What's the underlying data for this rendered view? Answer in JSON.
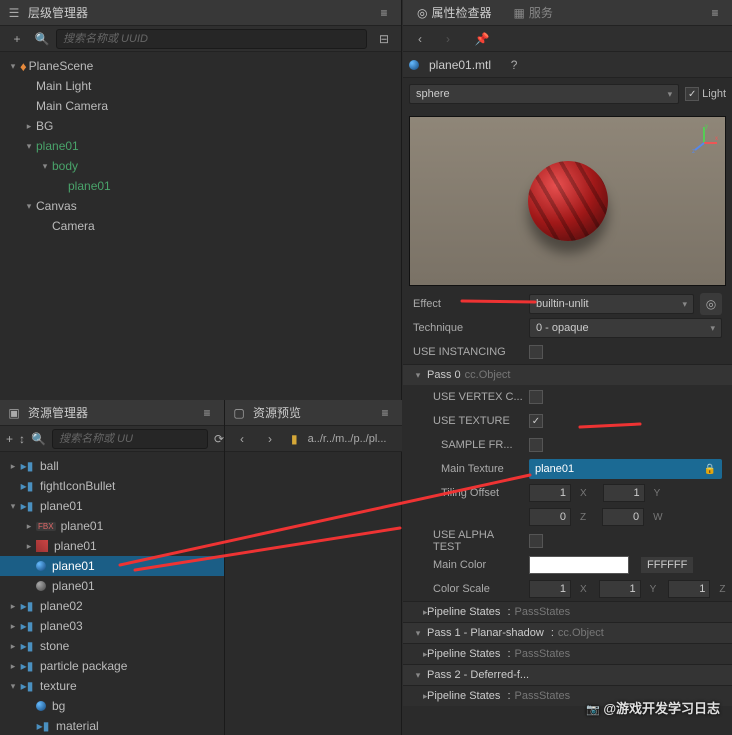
{
  "hierarchy": {
    "title": "层级管理器",
    "search_placeholder": "搜索名称或 UUID",
    "tree": [
      {
        "icon": "fire",
        "label": "PlaneScene",
        "depth": 0,
        "caret": "down"
      },
      {
        "icon": "",
        "label": "Main Light",
        "depth": 1
      },
      {
        "icon": "",
        "label": "Main Camera",
        "depth": 1
      },
      {
        "icon": "",
        "label": "BG",
        "depth": 1,
        "caret": "right"
      },
      {
        "icon": "",
        "label": "plane01",
        "depth": 1,
        "caret": "down",
        "active": true
      },
      {
        "icon": "",
        "label": "body",
        "depth": 2,
        "caret": "down",
        "active": true
      },
      {
        "icon": "",
        "label": "plane01",
        "depth": 3,
        "active": true
      },
      {
        "icon": "",
        "label": "Canvas",
        "depth": 1,
        "caret": "down"
      },
      {
        "icon": "",
        "label": "Camera",
        "depth": 2
      }
    ]
  },
  "assets": {
    "title": "资源管理器",
    "search_placeholder": "搜索名称或 UU",
    "tree": [
      {
        "icon": "folder",
        "label": "ball",
        "depth": 0,
        "caret": "right"
      },
      {
        "icon": "folder",
        "label": "fightIconBullet",
        "depth": 0
      },
      {
        "icon": "folder",
        "label": "plane01",
        "depth": 0,
        "caret": "down"
      },
      {
        "icon": "fbx",
        "label": "plane01",
        "depth": 1,
        "caret": "right"
      },
      {
        "icon": "img",
        "label": "plane01",
        "depth": 1,
        "caret": "right"
      },
      {
        "icon": "sphere-blue",
        "label": "plane01",
        "depth": 1,
        "selected": true
      },
      {
        "icon": "sphere-gray",
        "label": "plane01",
        "depth": 1
      },
      {
        "icon": "folder",
        "label": "plane02",
        "depth": 0,
        "caret": "right"
      },
      {
        "icon": "folder",
        "label": "plane03",
        "depth": 0,
        "caret": "right"
      },
      {
        "icon": "folder",
        "label": "stone",
        "depth": 0,
        "caret": "right"
      },
      {
        "icon": "folder",
        "label": "particle package",
        "depth": 0,
        "caret": "right"
      },
      {
        "icon": "folder",
        "label": "texture",
        "depth": 0,
        "caret": "down"
      },
      {
        "icon": "sphere-blue",
        "label": "bg",
        "depth": 1
      },
      {
        "icon": "folder",
        "label": "material",
        "depth": 1
      }
    ]
  },
  "preview": {
    "title": "资源预览",
    "breadcrumb": "a../r../m../p../pl..."
  },
  "inspector": {
    "title": "属性检查器",
    "services_tab": "服务",
    "asset_name": "plane01.mtl",
    "preview_mesh": "sphere",
    "light_label": "Light",
    "effect_label": "Effect",
    "effect_value": "builtin-unlit",
    "technique_label": "Technique",
    "technique_value": "0 - opaque",
    "use_instancing": "USE INSTANCING",
    "pass0": "Pass 0",
    "pass0_sub": "cc.Object",
    "use_vertex_color": "USE VERTEX C...",
    "use_texture": "USE TEXTURE",
    "sample_from_rt": "SAMPLE FR...",
    "main_texture": "Main Texture",
    "main_texture_value": "plane01",
    "tiling_offset": "Tiling Offset",
    "tiling": {
      "x": "1",
      "y": "1",
      "z": "0",
      "w": "0"
    },
    "use_alpha_test": "USE ALPHA TEST",
    "main_color": "Main Color",
    "main_color_hex": "FFFFFF",
    "color_scale": "Color Scale",
    "color_scale_vals": {
      "x": "1",
      "y": "1",
      "z": "1"
    },
    "pipeline_states": "Pipeline States",
    "pipeline_states_sub": "PassStates",
    "pass1": "Pass 1 - Planar-shadow",
    "pass1_sub": "cc.Object",
    "pass2": "Pass 2 - Deferred-f...",
    "pass2_sub": "PassStates"
  },
  "watermark": "@游戏开发学习日志"
}
